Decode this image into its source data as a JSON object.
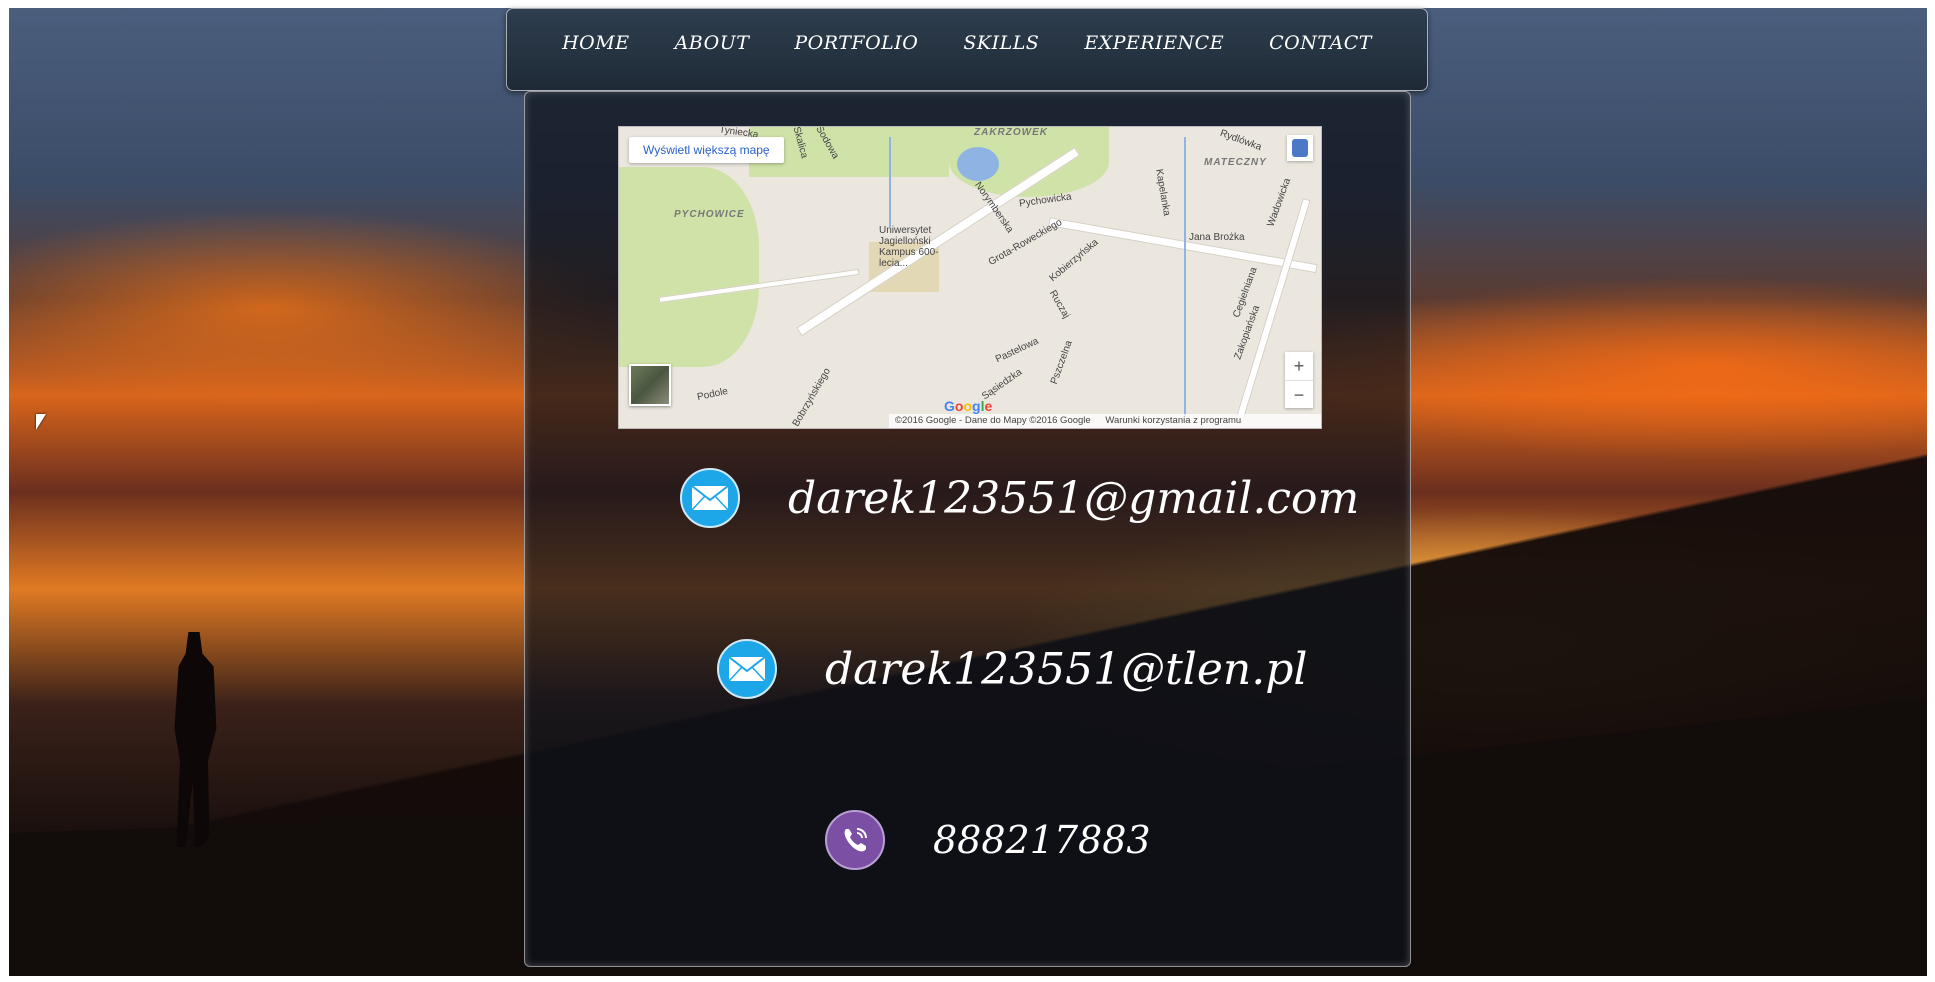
{
  "nav": {
    "items": [
      "HOME",
      "ABOUT",
      "PORTFOLIO",
      "SKILLS",
      "EXPERIENCE",
      "CONTACT"
    ]
  },
  "map": {
    "larger_map_button": "Wyświetl większą mapę",
    "zoom_in": "+",
    "zoom_out": "−",
    "google_logo": "Google",
    "copyright": "©2016 Google - Dane do Mapy ©2016 Google",
    "terms": "Warunki korzystania z programu",
    "labels": {
      "zakrzowek": "ZAKRZÓWEK",
      "pychowice": "PYCHOWICE",
      "mateczny": "MATECZNY",
      "campus": "Uniwersytet Jagielloński Kampus 600-lecia...",
      "grota": "Grota-Roweckiego",
      "pychowicka": "Pychowicka",
      "jana_brozka": "Jana Brożka",
      "kobierzynska": "Kobierzyńska",
      "norymberska": "Norymberska",
      "ruczaj": "Ruczaj",
      "pastelowa": "Pastelowa",
      "sasiedzka": "Sąsiedzka",
      "pszczelna": "Pszczelna",
      "podole": "Podole",
      "bobrzynskiego": "Bobrzyńskiego",
      "zakopianska": "Zakopiańska",
      "cegielniana": "Cegielniana",
      "kapelanka": "Kapelanka",
      "wadowicka": "Wadowicka",
      "rydlowka": "Rydlówka",
      "salwator": "Tyniecka",
      "skotnicka": "Sodowa",
      "szwedzka": "Skalica"
    }
  },
  "contacts": {
    "email1": "darek123551@gmail.com",
    "email2": "darek123551@tlen.pl",
    "phone": "888217883"
  },
  "colors": {
    "mail_icon": "#1ea7e8",
    "viber_icon": "#7b4fa4",
    "navbar": "#1f2a36"
  }
}
